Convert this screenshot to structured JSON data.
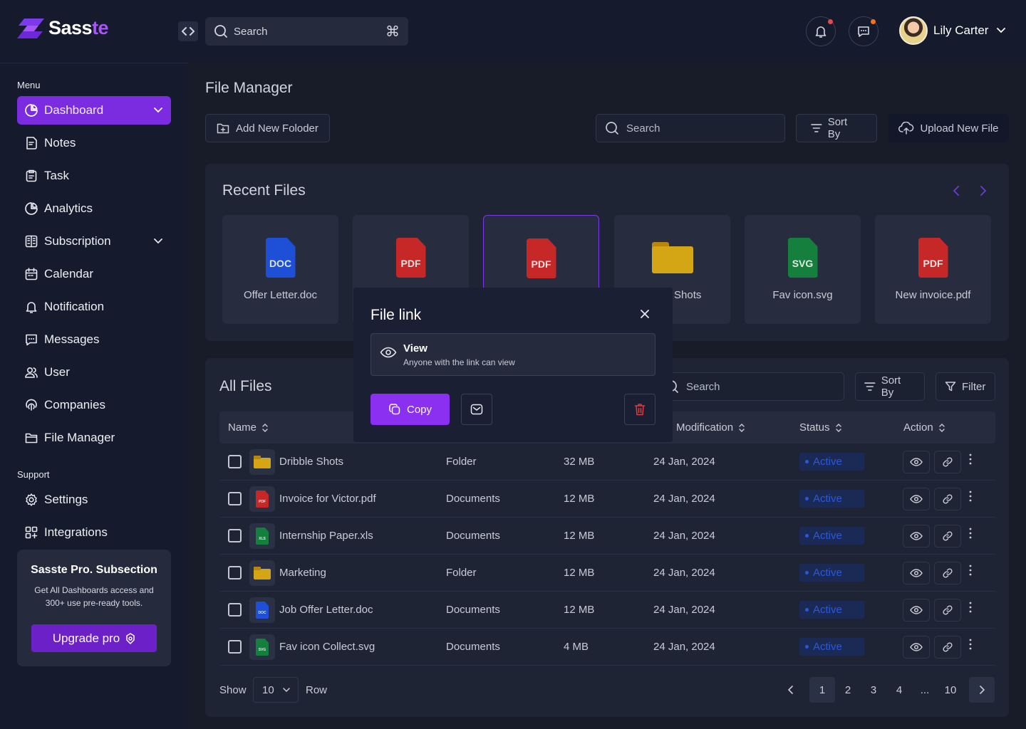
{
  "app": {
    "brand_part1": "Sass",
    "brand_part2": "te"
  },
  "topbar": {
    "search_placeholder": "Search",
    "shortcut": "⌘",
    "user_name": "Lily Carter",
    "notification_dot_color": "#e5484d",
    "message_dot_color": "#f97316"
  },
  "sidebar": {
    "menu_label": "Menu",
    "items": [
      {
        "label": "Dashboard",
        "icon": "pie-chart-icon",
        "active": true,
        "has_chevron": true
      },
      {
        "label": "Notes",
        "icon": "notes-icon"
      },
      {
        "label": "Task",
        "icon": "clipboard-icon"
      },
      {
        "label": "Analytics",
        "icon": "pie-chart-icon"
      },
      {
        "label": "Subscription",
        "icon": "grid-list-icon",
        "has_chevron": true
      },
      {
        "label": "Calendar",
        "icon": "calendar-icon"
      },
      {
        "label": "Notification",
        "icon": "bell-icon"
      },
      {
        "label": "Messages",
        "icon": "chat-icon"
      },
      {
        "label": "User",
        "icon": "users-icon"
      },
      {
        "label": "Companies",
        "icon": "fingerprint-icon"
      },
      {
        "label": "File Manager",
        "icon": "folder-icon"
      }
    ],
    "support_label": "Support",
    "support_items": [
      {
        "label": "Settings",
        "icon": "gear-icon"
      },
      {
        "label": "Integrations",
        "icon": "apps-icon"
      }
    ],
    "promo": {
      "title": "Sasste Pro. Subsection",
      "description": "Get All Dashboards access and 300+ use pre-ready tools.",
      "button_label": "Upgrade pro"
    }
  },
  "main": {
    "page_title": "File Manager",
    "add_folder_label": "Add New Foloder",
    "search_placeholder": "Search",
    "sort_label": "Sort By",
    "upload_label": "Upload New File",
    "recent": {
      "title": "Recent Files",
      "files": [
        {
          "name": "Offer Letter.doc",
          "type": "DOC",
          "color": "#1d4fd7"
        },
        {
          "name": "",
          "type": "PDF",
          "color": "#c62828"
        },
        {
          "name": "",
          "type": "PDF",
          "color": "#c62828",
          "selected": true
        },
        {
          "name": "Shots",
          "type": "folder",
          "color": "#d4a514"
        },
        {
          "name": "Fav icon.svg",
          "type": "SVG",
          "color": "#15803d"
        },
        {
          "name": "New invoice.pdf",
          "type": "PDF",
          "color": "#c62828"
        }
      ]
    },
    "all_files": {
      "title": "All Files",
      "search_placeholder": "Search",
      "sort_label": "Sort By",
      "filter_label": "Filter",
      "columns": [
        "Name",
        "Modification",
        "Status",
        "Action"
      ],
      "rows": [
        {
          "name": "Dribble Shots",
          "kind": "folder",
          "type": "Folder",
          "size": "32 MB",
          "date": "24 Jan, 2024",
          "status": "Active"
        },
        {
          "name": "Invoice for Victor.pdf",
          "kind": "PDF",
          "color": "#c62828",
          "type": "Documents",
          "size": "12 MB",
          "date": "24 Jan, 2024",
          "status": "Active"
        },
        {
          "name": "Internship Paper.xls",
          "kind": "XLS",
          "color": "#15803d",
          "type": "Documents",
          "size": "12 MB",
          "date": "24 Jan, 2024",
          "status": "Active"
        },
        {
          "name": "Marketing",
          "kind": "folder",
          "type": "Folder",
          "size": "12 MB",
          "date": "24 Jan, 2024",
          "status": "Active"
        },
        {
          "name": "Job Offer Letter.doc",
          "kind": "DOC",
          "color": "#1d4fd7",
          "type": "Documents",
          "size": "12 MB",
          "date": "24 Jan, 2024",
          "status": "Active"
        },
        {
          "name": "Fav icon Collect.svg",
          "kind": "SVG",
          "color": "#15803d",
          "type": "Documents",
          "size": "4 MB",
          "date": "24 Jan, 2024",
          "status": "Active"
        }
      ],
      "footer": {
        "show_label": "Show",
        "rows_value": "10",
        "row_label": "Row",
        "pages": [
          "1",
          "2",
          "3",
          "4",
          "...",
          "10"
        ],
        "current_page": "1"
      }
    }
  },
  "modal": {
    "title": "File link",
    "view_title": "View",
    "view_desc": "Anyone with the link can view",
    "copy_label": "Copy"
  }
}
